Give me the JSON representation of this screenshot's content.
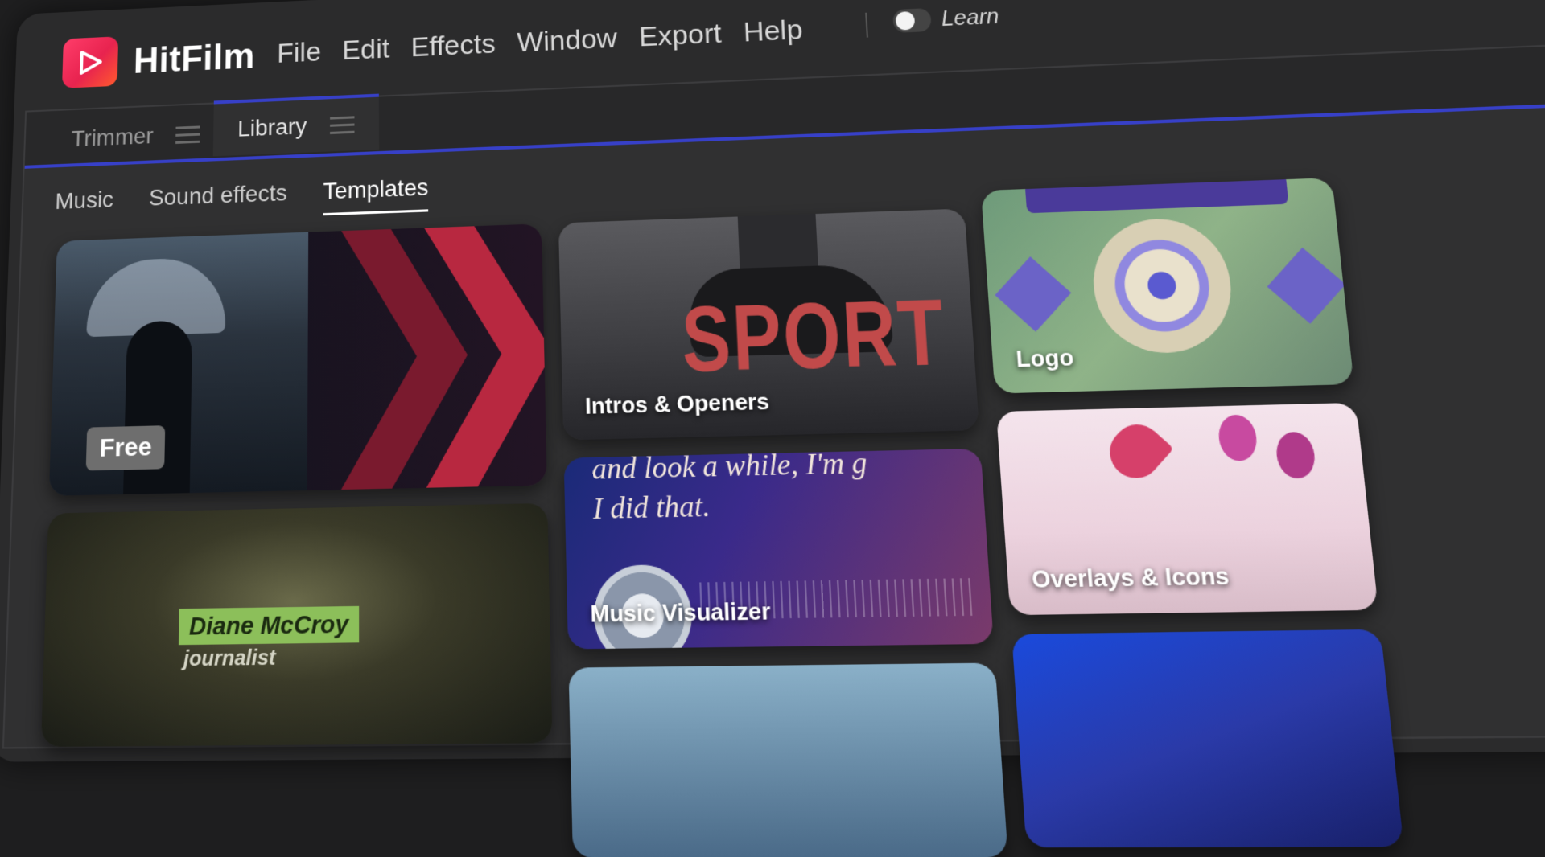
{
  "app": {
    "name": "HitFilm",
    "brand_color": "#ea2a55",
    "accent_color": "#3740c8"
  },
  "menu": {
    "items": [
      "File",
      "Edit",
      "Effects",
      "Window",
      "Export",
      "Help"
    ]
  },
  "learn_toggle": {
    "label": "Learn",
    "state": "off"
  },
  "panel_tabs": [
    {
      "label": "Trimmer",
      "active": false
    },
    {
      "label": "Library",
      "active": true
    }
  ],
  "library_tabs": [
    {
      "label": "Music",
      "active": false
    },
    {
      "label": "Sound effects",
      "active": false
    },
    {
      "label": "Templates",
      "active": true
    }
  ],
  "cards": {
    "free": {
      "badge": "Free"
    },
    "intros": {
      "label": "Intros & Openers",
      "art_text": "SPORT"
    },
    "logo": {
      "label": "Logo"
    },
    "diane": {
      "name": "Diane McCroy",
      "role": "journalist"
    },
    "visualizer": {
      "label": "Music Visualizer",
      "quote_top": "and look a while, I'm g",
      "quote_main": "I did that."
    },
    "overlays": {
      "label": "Overlays & Icons"
    }
  }
}
